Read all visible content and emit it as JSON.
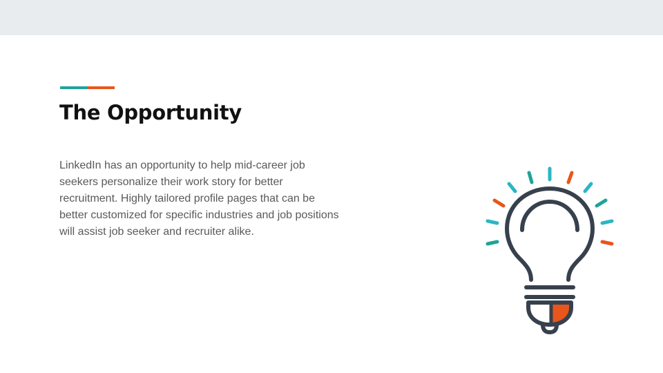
{
  "slide": {
    "title": "The Opportunity",
    "body": "LinkedIn has an opportunity to help mid-career job seekers personalize their work story for better recruitment. Highly tailored profile pages that can be better customized for specific industries and job positions will assist job seeker and recruiter alike."
  },
  "colors": {
    "teal": "#1fa39a",
    "orange": "#e8561c",
    "cyan": "#2bb6c4",
    "outline": "#37414d",
    "band": "#e8ecee"
  },
  "icons": {
    "illustration": "lightbulb-icon"
  }
}
